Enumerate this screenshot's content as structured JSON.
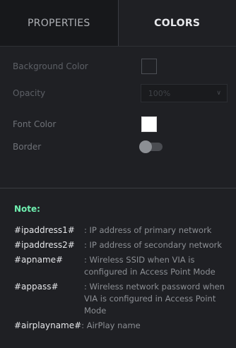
{
  "tabs": [
    {
      "label": "PROPERTIES",
      "active": false
    },
    {
      "label": "COLORS",
      "active": true
    }
  ],
  "properties": {
    "background_color": {
      "label": "Background Color"
    },
    "opacity": {
      "label": "Opacity",
      "value": "100%"
    },
    "font_color": {
      "label": "Font Color",
      "color": "#ffffff"
    },
    "border": {
      "label": "Border",
      "enabled": false
    }
  },
  "note": {
    "title": "Note:",
    "items": [
      {
        "key": "#ipaddress1#",
        "desc": ": IP address of primary network"
      },
      {
        "key": "#ipaddress2#",
        "desc": ": IP address of secondary network"
      },
      {
        "key": "#apname#",
        "desc": ": Wireless SSID when VIA is configured in Access Point Mode"
      },
      {
        "key": "#appass#",
        "desc": ": Wireless network password when VIA is configured in Access Point Mode"
      },
      {
        "key": "#airplayname#",
        "desc": ": AirPlay name"
      }
    ]
  },
  "colors": {
    "accent_note": "#6ff0b0",
    "background": "#1f2024"
  }
}
